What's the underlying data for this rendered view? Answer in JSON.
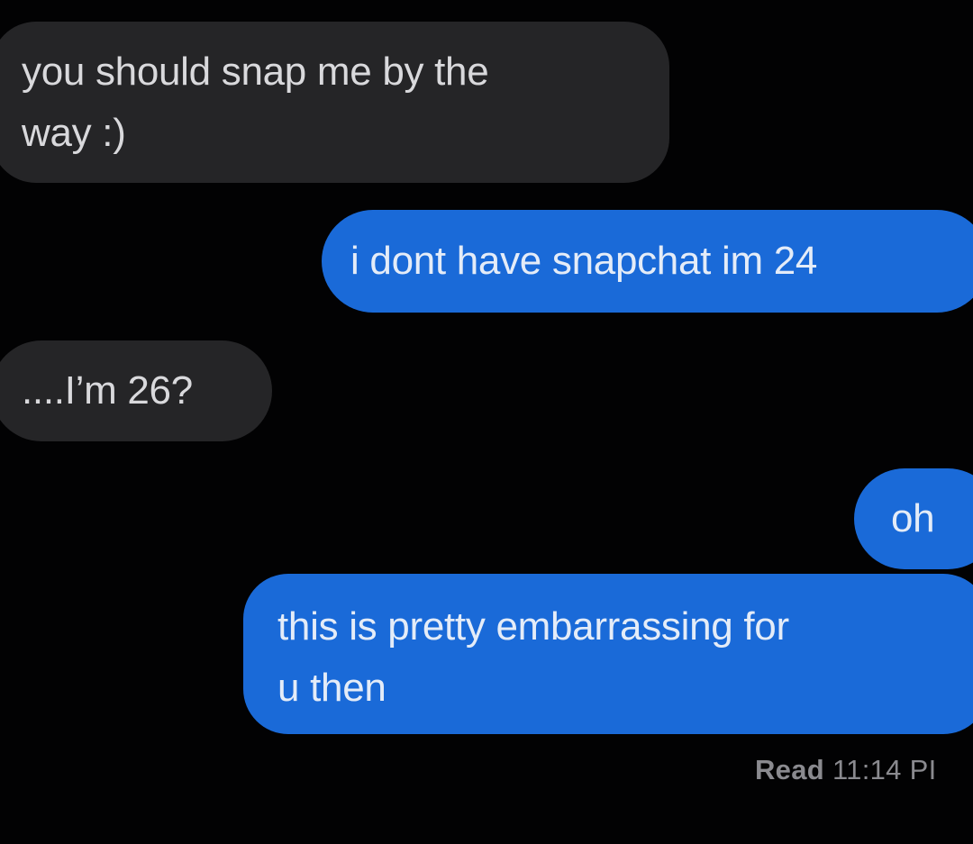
{
  "conversation": {
    "messages": [
      {
        "direction": "received",
        "lines": [
          "you should snap me by the",
          "way :)"
        ]
      },
      {
        "direction": "sent",
        "lines": [
          "i dont have snapchat im 24"
        ]
      },
      {
        "direction": "received",
        "lines": [
          "....I’m 26?"
        ]
      },
      {
        "direction": "sent",
        "lines": [
          "oh"
        ]
      },
      {
        "direction": "sent",
        "lines": [
          "this is pretty embarrassing for",
          "u then"
        ]
      }
    ],
    "read_receipt": {
      "label": "Read",
      "time": "11:14 PI"
    }
  },
  "colors": {
    "background": "#020203",
    "received_bubble": "#252527",
    "sent_bubble": "#1a6ad8",
    "status_text": "#8a8a8f"
  }
}
